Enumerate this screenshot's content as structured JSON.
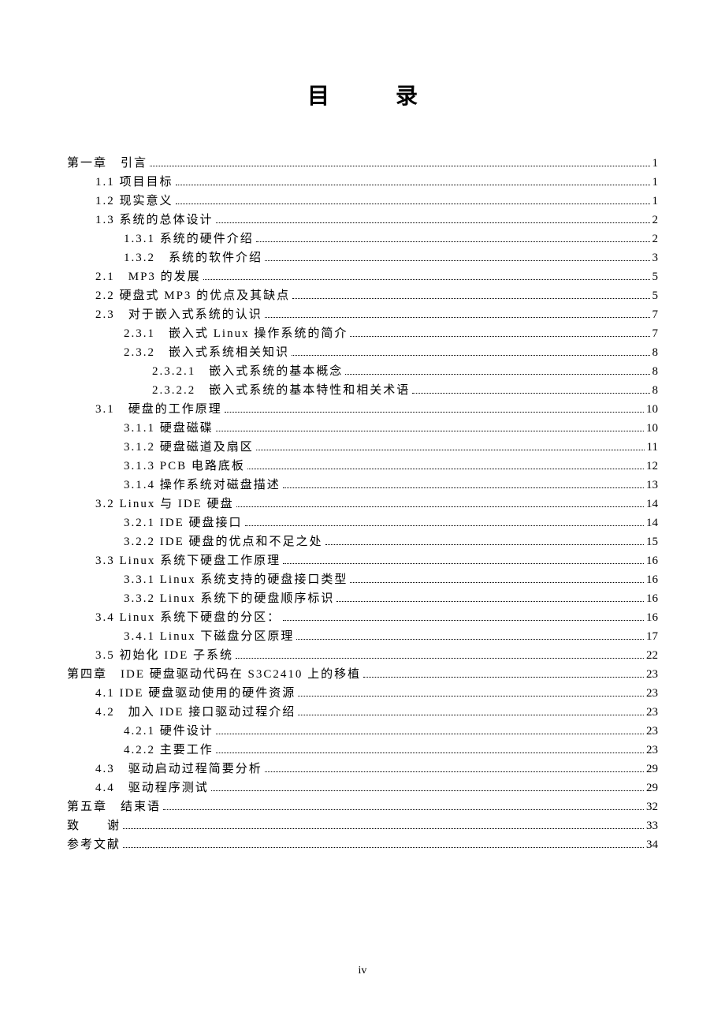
{
  "title_left": "目",
  "title_right": "录",
  "page_number": "iv",
  "toc": [
    {
      "level": 0,
      "label": "第一章　引言",
      "page": "1"
    },
    {
      "level": 1,
      "label": "1.1 项目目标",
      "page": "1"
    },
    {
      "level": 1,
      "label": "1.2 现实意义",
      "page": "1"
    },
    {
      "level": 1,
      "label": "1.3 系统的总体设计",
      "page": "2"
    },
    {
      "level": 2,
      "label": "1.3.1 系统的硬件介绍",
      "page": "2"
    },
    {
      "level": 2,
      "label": "1.3.2　系统的软件介绍",
      "page": "3"
    },
    {
      "level": 1,
      "label": "2.1　MP3 的发展",
      "page": "5"
    },
    {
      "level": 1,
      "label": "2.2 硬盘式 MP3 的优点及其缺点",
      "page": "5"
    },
    {
      "level": 1,
      "label": "2.3　对于嵌入式系统的认识",
      "page": "7"
    },
    {
      "level": 2,
      "label": "2.3.1　嵌入式 Linux 操作系统的简介",
      "page": "7"
    },
    {
      "level": 2,
      "label": "2.3.2　嵌入式系统相关知识",
      "page": "8"
    },
    {
      "level": 3,
      "label": "2.3.2.1　嵌入式系统的基本概念",
      "page": "8"
    },
    {
      "level": 3,
      "label": "2.3.2.2　嵌入式系统的基本特性和相关术语",
      "page": "8"
    },
    {
      "level": 1,
      "label": "3.1　硬盘的工作原理",
      "page": "10"
    },
    {
      "level": 2,
      "label": "3.1.1 硬盘磁碟",
      "page": "10"
    },
    {
      "level": 2,
      "label": "3.1.2 硬盘磁道及扇区",
      "page": "11"
    },
    {
      "level": 2,
      "label": "3.1.3 PCB 电路底板",
      "page": "12"
    },
    {
      "level": 2,
      "label": "3.1.4 操作系统对磁盘描述",
      "page": "13"
    },
    {
      "level": 1,
      "label": "3.2 Linux 与 IDE 硬盘",
      "page": "14"
    },
    {
      "level": 2,
      "label": "3.2.1 IDE 硬盘接口",
      "page": "14"
    },
    {
      "level": 2,
      "label": "3.2.2 IDE 硬盘的优点和不足之处",
      "page": "15"
    },
    {
      "level": 1,
      "label": "3.3 Linux 系统下硬盘工作原理",
      "page": "16"
    },
    {
      "level": 2,
      "label": "3.3.1 Linux 系统支持的硬盘接口类型",
      "page": "16"
    },
    {
      "level": 2,
      "label": "3.3.2 Linux 系统下的硬盘顺序标识",
      "page": "16"
    },
    {
      "level": 1,
      "label": "3.4 Linux 系统下硬盘的分区：",
      "page": "16"
    },
    {
      "level": 2,
      "label": "3.4.1 Linux 下磁盘分区原理",
      "page": "17"
    },
    {
      "level": 1,
      "label": "3.5 初始化 IDE 子系统",
      "page": "22"
    },
    {
      "level": 0,
      "label": "第四章　IDE 硬盘驱动代码在 S3C2410 上的移植",
      "page": "23"
    },
    {
      "level": 1,
      "label": "4.1 IDE 硬盘驱动使用的硬件资源",
      "page": "23"
    },
    {
      "level": 1,
      "label": "4.2　加入 IDE 接口驱动过程介绍",
      "page": "23"
    },
    {
      "level": 2,
      "label": "4.2.1 硬件设计",
      "page": "23"
    },
    {
      "level": 2,
      "label": "4.2.2 主要工作",
      "page": "23"
    },
    {
      "level": 1,
      "label": "4.3　驱动启动过程简要分析",
      "page": "29"
    },
    {
      "level": 1,
      "label": "4.4　驱动程序测试",
      "page": "29"
    },
    {
      "level": 0,
      "label": "第五章　结束语",
      "page": "32"
    },
    {
      "level": 0,
      "label": "致　　谢",
      "page": "33"
    },
    {
      "level": 0,
      "label": "参考文献",
      "page": "34"
    }
  ]
}
